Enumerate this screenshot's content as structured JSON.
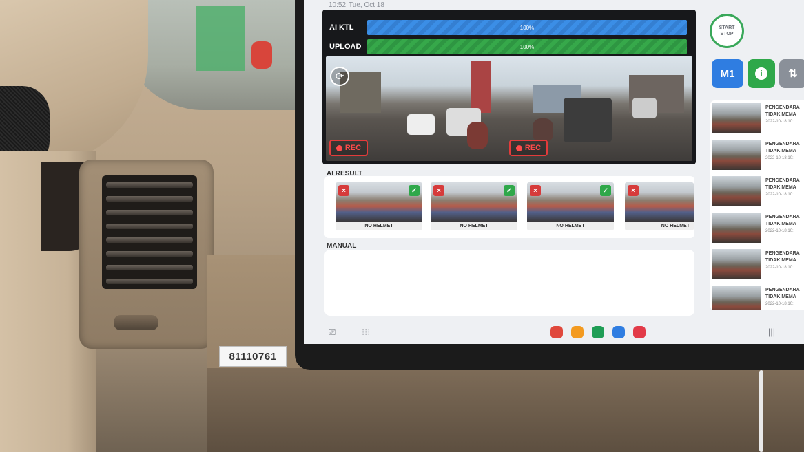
{
  "sticker": {
    "text": "81110761"
  },
  "tablet": {
    "status_time": "10:52",
    "status_date": "Tue, Oct 18",
    "progress": [
      {
        "label": "AI KTL",
        "value_text": "100%",
        "value": 1.0,
        "color": "#3b8ee6"
      },
      {
        "label": "UPLOAD",
        "value_text": "100%",
        "value": 1.0,
        "color": "#36a84a"
      }
    ],
    "rec_label": "REC",
    "ai_result_label": "AI RESULT",
    "results": [
      {
        "label": "NO HELMET",
        "reject": "×",
        "accept": "✓"
      },
      {
        "label": "NO HELMET",
        "reject": "×",
        "accept": "✓"
      },
      {
        "label": "NO HELMET",
        "reject": "×",
        "accept": "✓"
      },
      {
        "label": "NO HELMET",
        "reject": "×",
        "accept": ""
      }
    ],
    "manual_label": "MANUAL",
    "start_stop": {
      "line1": "START",
      "line2": "STOP"
    },
    "mode_buttons": {
      "m1": "M1",
      "info": "i",
      "sort": "⇅"
    },
    "list": [
      {
        "line1": "PENGENDARA",
        "line2": "TIDAK MEMA",
        "date": "2022-10-18 10:"
      },
      {
        "line1": "PENGENDARA",
        "line2": "TIDAK MEMA",
        "date": "2022-10-18 10:"
      },
      {
        "line1": "PENGENDARA",
        "line2": "TIDAK MEMA",
        "date": "2022-10-18 10:"
      },
      {
        "line1": "PENGENDARA",
        "line2": "TIDAK MEMA",
        "date": "2022-10-18 10:"
      },
      {
        "line1": "PENGENDARA",
        "line2": "TIDAK MEMA",
        "date": "2022-10-18 10:"
      },
      {
        "line1": "PENGENDARA",
        "line2": "TIDAK MEMA",
        "date": "2022-10-18 10:"
      }
    ],
    "nav": {
      "recents": "|||"
    },
    "colors": {
      "accent_blue": "#2f7de1",
      "accent_green": "#2fa84a",
      "reject_red": "#d63b3b",
      "rec_red": "#e33b3b"
    }
  }
}
